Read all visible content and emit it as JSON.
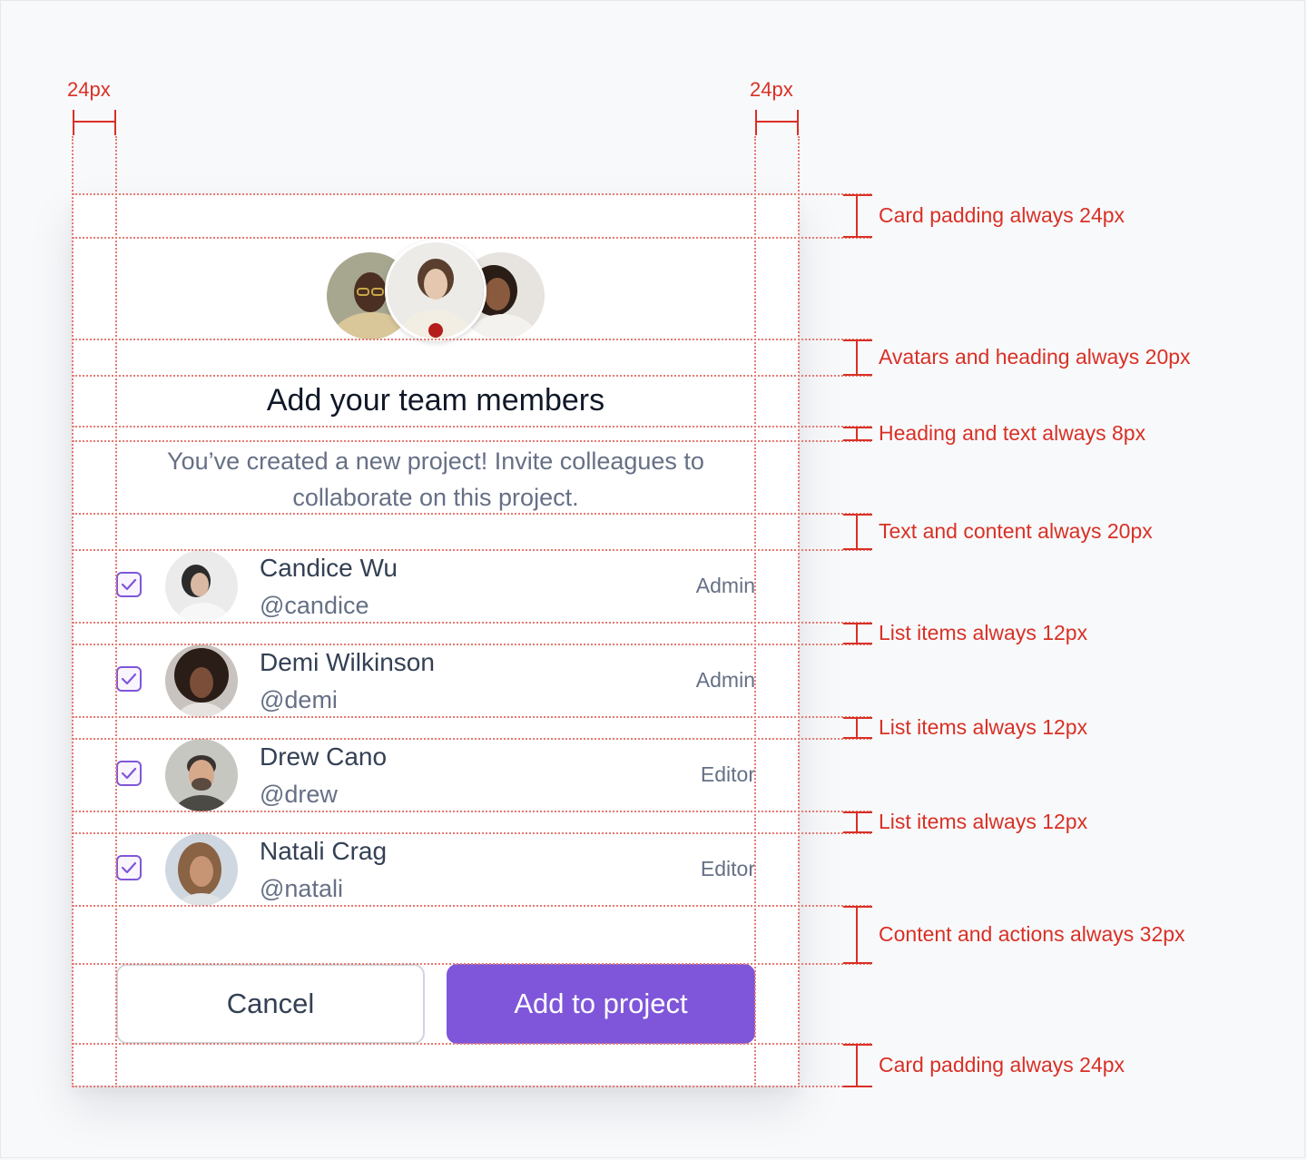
{
  "dimensions": {
    "left_label": "24px",
    "right_label": "24px"
  },
  "annotations": [
    "Card padding always 24px",
    "Avatars and heading always 20px",
    "Heading and text always 8px",
    "Text and content always 20px",
    "List items always 12px",
    "List items always 12px",
    "List items always 12px",
    "Content and actions always 32px",
    "Card padding always 24px"
  ],
  "card": {
    "title": "Add your team members",
    "subtitle": "You’ve created a new project! Invite colleagues to collaborate on this project.",
    "members": [
      {
        "name": "Candice Wu",
        "handle": "@candice",
        "role": "Admin",
        "checked": true
      },
      {
        "name": "Demi Wilkinson",
        "handle": "@demi",
        "role": "Admin",
        "checked": true
      },
      {
        "name": "Drew Cano",
        "handle": "@drew",
        "role": "Editor",
        "checked": true
      },
      {
        "name": "Natali Crag",
        "handle": "@natali",
        "role": "Editor",
        "checked": true
      }
    ],
    "actions": {
      "cancel": "Cancel",
      "confirm": "Add to project"
    }
  },
  "colors": {
    "accent": "#7f56d9",
    "annotation": "#d93025"
  }
}
